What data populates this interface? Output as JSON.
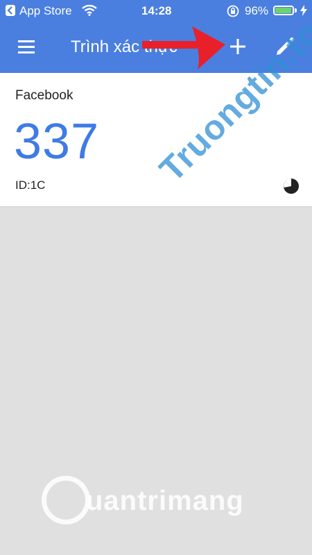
{
  "status_bar": {
    "carrier": "App Store",
    "time": "14:28",
    "battery_percent": "96%"
  },
  "app_bar": {
    "title": "Trình xác thực",
    "menu_icon": "hamburger-menu-icon",
    "add_icon": "plus-icon",
    "edit_icon": "pencil-icon"
  },
  "account": {
    "issuer": "Facebook",
    "code": "337",
    "id_label": "ID:1C",
    "timer_icon": "countdown-pie-icon"
  },
  "watermarks": {
    "diagonal": "Truongtin.top",
    "bottom": "uantrimang"
  },
  "colors": {
    "app_bar": "#4a7fe0",
    "code": "#3f7be5",
    "background": "#e0e0e0",
    "arrow": "#e8202a"
  }
}
